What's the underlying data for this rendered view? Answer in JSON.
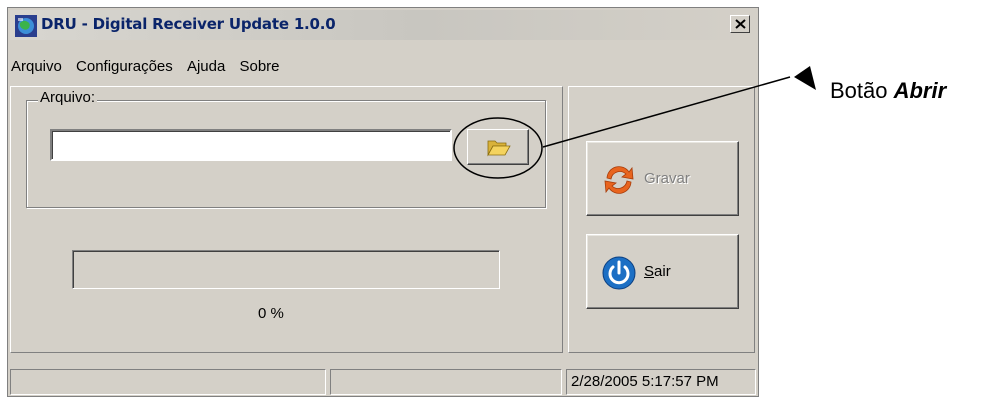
{
  "window": {
    "title": "DRU - Digital Receiver Update 1.0.0",
    "close_symbol": "×"
  },
  "menu": [
    {
      "label": "Arquivo"
    },
    {
      "label": "Configurações"
    },
    {
      "label": "Ajuda"
    },
    {
      "label": "Sobre"
    }
  ],
  "file_group": {
    "label": "Arquivo:",
    "path_value": "",
    "open_button_icon": "folder-open-icon"
  },
  "progress": {
    "value_percent": 0,
    "text": "0 %"
  },
  "buttons": {
    "gravar": {
      "label": "Gravar",
      "enabled": false,
      "icon": "refresh-arrows-icon"
    },
    "sair": {
      "label_hotkey": "S",
      "label_rest": "air",
      "icon": "power-icon"
    }
  },
  "statusbar": {
    "pane1": "",
    "pane2": "",
    "datetime": "2/28/2005 5:17:57 PM"
  },
  "annotation": {
    "prefix": "Botão ",
    "emphasis": "Abrir"
  },
  "colors": {
    "window_face": "#d4d0c8",
    "title_text": "#0a246a",
    "gravar_orange": "#e8641e",
    "sair_blue": "#1c6fc4",
    "folder_yellow": "#f4d35e"
  }
}
